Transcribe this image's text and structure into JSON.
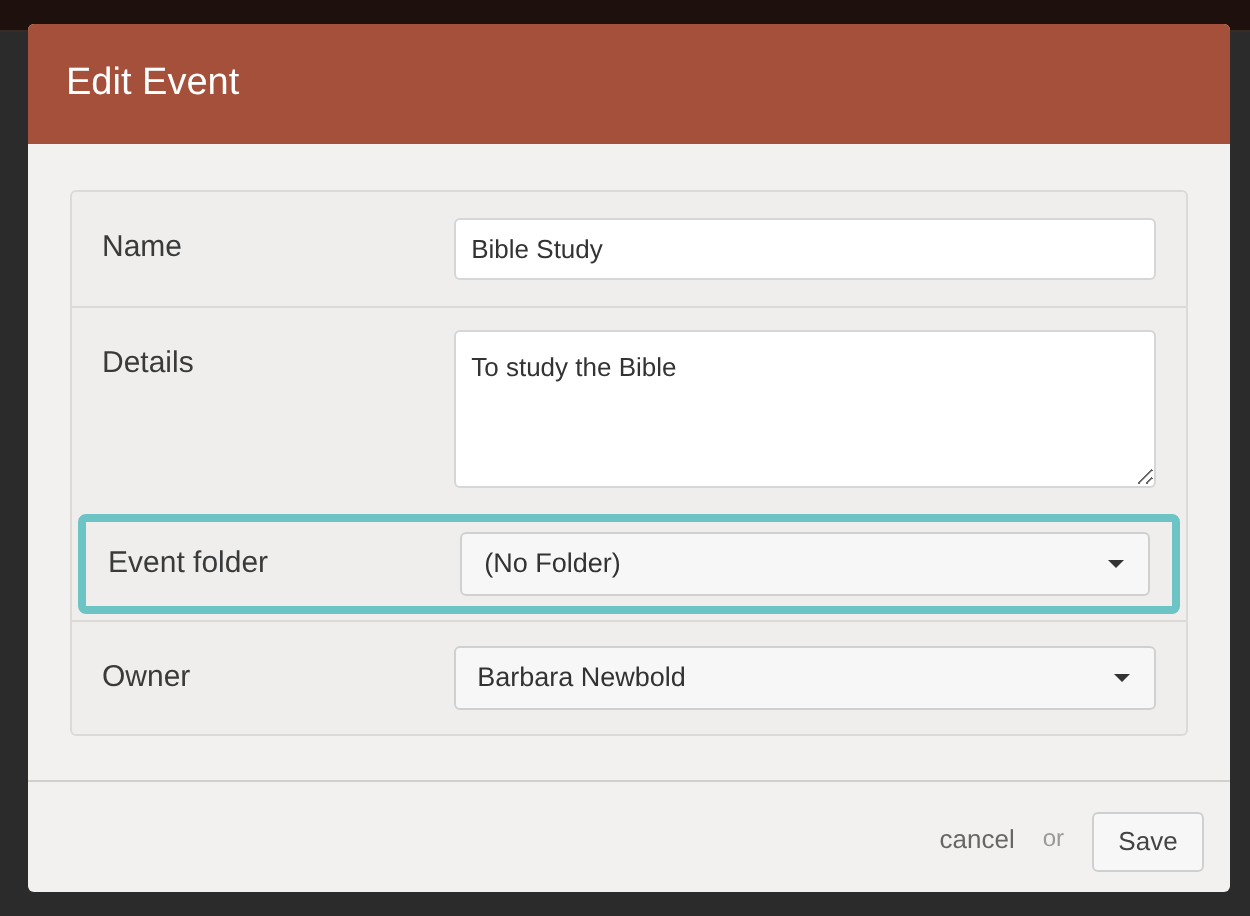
{
  "dialog": {
    "title": "Edit Event",
    "fields": [
      {
        "kind": "text",
        "label": "Name",
        "value": "Bible Study",
        "highlighted": false
      },
      {
        "kind": "textarea",
        "label": "Details",
        "value": "To study the Bible",
        "highlighted": false
      },
      {
        "kind": "select",
        "label": "Event folder",
        "value": "(No Folder)",
        "highlighted": true
      },
      {
        "kind": "select",
        "label": "Owner",
        "value": "Barbara Newbold",
        "highlighted": false
      }
    ],
    "footer": {
      "cancel": "cancel",
      "separator": "or",
      "save": "Save"
    }
  }
}
